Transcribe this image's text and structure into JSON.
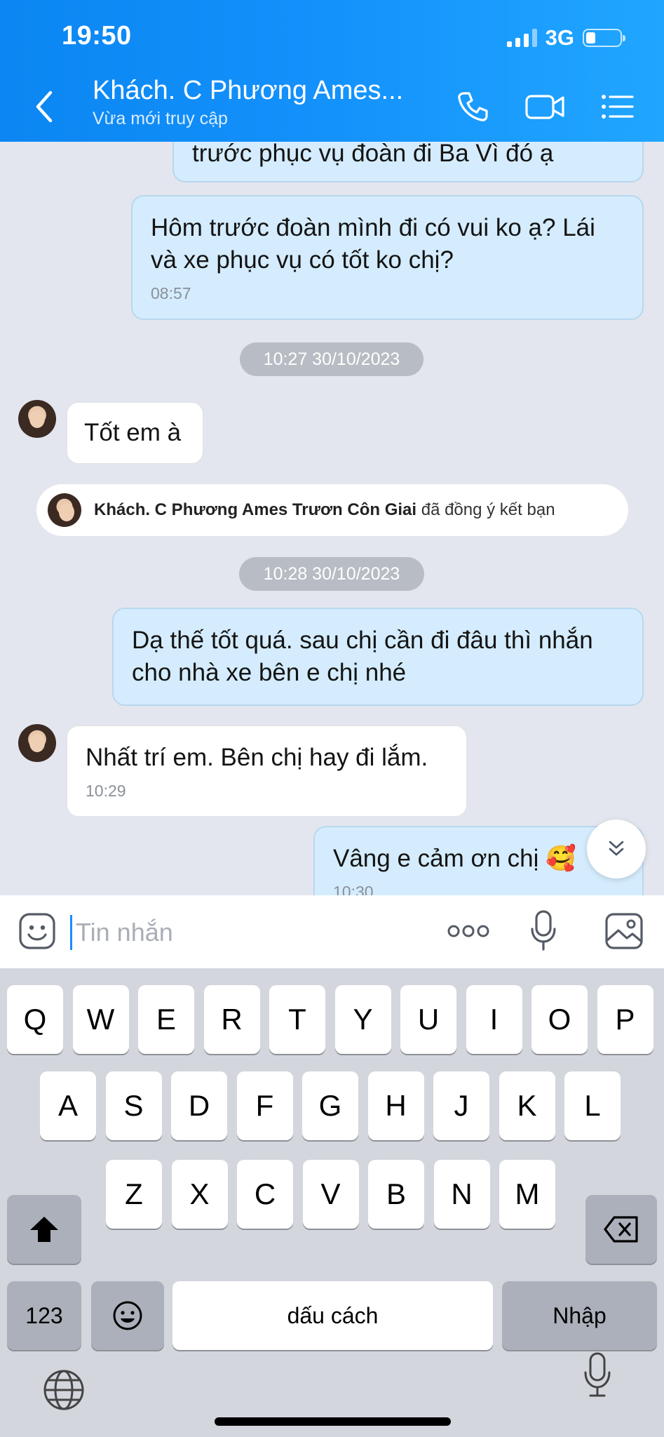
{
  "status_bar": {
    "time": "19:50",
    "network": "3G"
  },
  "header": {
    "title": "Khách. C Phương Ames...",
    "subtitle": "Vừa mới truy cập"
  },
  "messages": {
    "partial_out": "trước phục vụ đoàn đi Ba Vì đó ạ",
    "out1": {
      "text": "Hôm trước đoàn mình đi có vui ko ạ? Lái và xe phục vụ có tốt ko chị?",
      "time": "08:57"
    },
    "date1": "10:27 30/10/2023",
    "in1": {
      "text": "Tốt em à"
    },
    "friend_notice": {
      "name": "Khách. C Phương Ames Trươn Côn Giai",
      "action": "đã đồng ý kết bạn"
    },
    "date2": "10:28 30/10/2023",
    "out2": {
      "text": "Dạ thế tốt quá. sau chị cần đi đâu thì nhắn cho nhà xe bên e chị nhé"
    },
    "in2": {
      "text": "Nhất trí em. Bên chị hay đi lắm.",
      "time": "10:29"
    },
    "out3": {
      "text": "Vâng e cảm ơn chị 🥰",
      "time": "10:30"
    }
  },
  "input": {
    "placeholder": "Tin nhắn"
  },
  "keyboard": {
    "row1": [
      "Q",
      "W",
      "E",
      "R",
      "T",
      "Y",
      "U",
      "I",
      "O",
      "P"
    ],
    "row2": [
      "A",
      "S",
      "D",
      "F",
      "G",
      "H",
      "J",
      "K",
      "L"
    ],
    "row3": [
      "Z",
      "X",
      "C",
      "V",
      "B",
      "N",
      "M"
    ],
    "numbers_key": "123",
    "space_key": "dấu cách",
    "return_key": "Nhập"
  },
  "icons": [
    "back-chevron-icon",
    "phone-icon",
    "video-call-icon",
    "menu-list-icon",
    "emoji-sticker-icon",
    "more-dots-icon",
    "microphone-icon",
    "image-icon",
    "chevrons-down-icon",
    "shift-icon",
    "backspace-icon",
    "emoji-key-icon",
    "globe-icon",
    "dictation-mic-icon"
  ]
}
